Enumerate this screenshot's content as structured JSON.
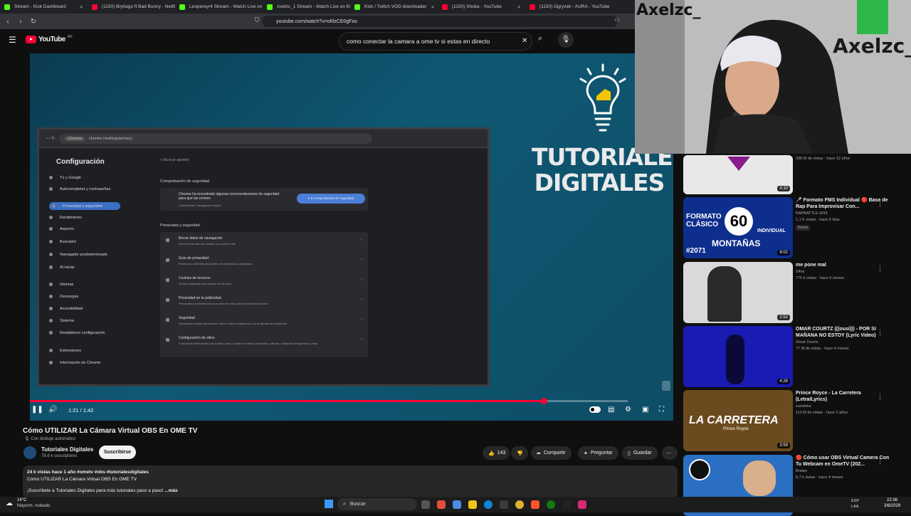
{
  "tabs": [
    {
      "label": "Stream - Kick Dashboard",
      "color": "#53fc18"
    },
    {
      "label": "(1150) Brytiago ft Bad Bunny - Netfli",
      "color": "#ff0033"
    },
    {
      "label": "Leopereyr4 Stream - Watch Live on Kick",
      "color": "#53fc18"
    },
    {
      "label": "Axelzc_1 Stream - Watch Live on Kick",
      "color": "#53fc18"
    },
    {
      "label": "Kick / Twitch VOD downloader",
      "color": "#53fc18"
    },
    {
      "label": "(1150) Shoka - YouTube",
      "color": "#ff0033"
    },
    {
      "label": "(1150) Ogryzek - AURA - YouTube",
      "color": "#ff0033"
    }
  ],
  "address": {
    "url": "youtube.com/watch?v=o6lzCE0gFxo"
  },
  "youtube": {
    "logo": "YouTube",
    "country": "AR",
    "search_query": "como conectar la camara a ome tv si estas en directo"
  },
  "video": {
    "overlay_title": "TUTORIALES DIGITALES",
    "current_time": "1:21 / 1:42",
    "progress": 0.86,
    "settings_page": {
      "url": "chrome://settings/privacy",
      "chrome_label": "Chrome",
      "heading": "Configuración",
      "search_placeholder": "Buscar ajustes",
      "sidebar": [
        "Tú y Google",
        "Autocompletar y contraseñas",
        "Privacidad y seguridad",
        "Rendimiento",
        "Aspecto",
        "Buscador",
        "Navegador predeterminado",
        "Al iniciar",
        "Idiomas",
        "Descargas",
        "Accesibilidad",
        "Sistema",
        "Restablecer configuración",
        "Extensiones",
        "Información de Chrome"
      ],
      "safety_heading": "Comprobación de seguridad",
      "safety_text": "Chrome ha encontrado algunas recomendaciones de seguridad para que las revises",
      "safety_sub": "Contraseñas, Navegación segura",
      "safety_button": "Ir a Comprobación de seguridad",
      "privacy_heading": "Privacidad y seguridad",
      "rows": [
        {
          "title": "Borrar datos de navegación",
          "sub": "Borra el historial, las cookies, la caché y más"
        },
        {
          "title": "Guía de privacidad",
          "sub": "Revisa los controles principales de privacidad y seguridad"
        },
        {
          "title": "Cookies de terceros",
          "sub": "Se han bloqueado las cookies de terceros"
        },
        {
          "title": "Privacidad en la publicidad",
          "sub": "Personaliza la información que usan los sitios para mostrarte anuncios"
        },
        {
          "title": "Seguridad",
          "sub": "Navegación segura (protección frente a sitios peligrosos) y otros ajustes de seguridad"
        },
        {
          "title": "Configuración de sitios",
          "sub": "Controla la información que pueden usar y mostrar los sitios (ubicación, cámara, ventanas emergentes y más)"
        }
      ]
    }
  },
  "below": {
    "title": "Cómo UTILIZAR La Cámara Virtual OBS En OME TV",
    "dubbing": "Con doblaje automático",
    "channel": "Tutoriales Digitales",
    "subs": "78.6 k suscriptores",
    "subscribe": "Suscribirse",
    "likes": "143",
    "share": "Compartir",
    "ask": "Preguntar",
    "save": "Guardar",
    "desc_meta": "24 k vistas  hace 1 año  #ometv #obs #tutorialesdigitales",
    "desc_title": "Cómo UTILIZAR La Cámara Virtual OBS En OME TV",
    "desc_more": "¡Suscríbete a Tutoriales Digitales para más tutoriales paso a paso!",
    "more": "...más"
  },
  "webcam": {
    "brand": "Axelzc_"
  },
  "sidebar": [
    {
      "title": "",
      "channel": "",
      "meta": "338 M de vistas · hace 12 años",
      "duration": "4:10",
      "thumb": "#e8e8e8"
    },
    {
      "title": "🎤 Formato FMS Individual 🔴 Base de Rap Para Improvisar Con...",
      "channel": "RAPBATTLE-ENS",
      "meta": "1,1 K vistas · hace 6 días",
      "duration": "8:02",
      "thumb": "#0d2e8c",
      "badge": "Nuevo"
    },
    {
      "title": "me pone mal",
      "channel": "S4nx",
      "meta": "776 k vistas · hace 5 meses",
      "duration": "2:52",
      "thumb": "#d9d9d9"
    },
    {
      "title": "OMAR COURTZ (((ousi))) - POR SI MAÑANA NO ESTOY (Lyric Video)",
      "channel": "Omar Courtz",
      "meta": "77 M de vistas · hace 4 meses",
      "duration": "4:26",
      "thumb": "#1a1bb3"
    },
    {
      "title": "Prince Royce - La Carretera (Letra/Lyrics)",
      "channel": "sunshine",
      "meta": "112 M de vistas · hace 2 años",
      "duration": "3:59",
      "thumb": "#6b4a1f"
    },
    {
      "title": "🔴 Cómo usar OBS Virtual Camera Con Tu Webcam en OmeTV (202...",
      "channel": "Braian",
      "meta": "6,7 k vistas · hace 4 meses",
      "duration": "",
      "thumb": "#2b6fc2"
    }
  ],
  "thumb_text": {
    "formato": "FORMATO CLÁSICO",
    "sixty": "60",
    "individual": "INDIVIDUAL",
    "montanas": "MONTAÑAS",
    "num": "#2071",
    "carretera": "LA CARRETERA",
    "prince": "Prince Royce"
  },
  "taskbar": {
    "weather_temp": "14°C",
    "weather_desc": "Mayorm. nublado",
    "search": "Buscar",
    "lang": "ESP\nLAA",
    "time": "22:36",
    "date": "3/8/2026"
  }
}
